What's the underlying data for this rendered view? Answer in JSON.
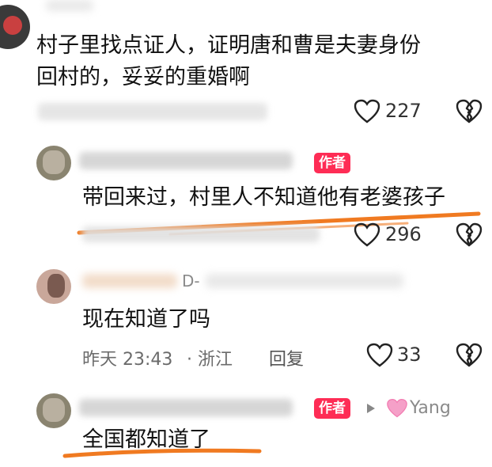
{
  "comments": [
    {
      "text_lines": [
        "村子里找点证人，证明唐和曹是夫妻身份",
        "回村的，妥妥的重婚啊"
      ],
      "likes": "227"
    },
    {
      "badge": "作者",
      "text": "带回来过，村里人不知道他有老婆孩子",
      "likes": "296"
    },
    {
      "username_partial": "D-",
      "text": "现在知道了吗",
      "time": "昨天 23:43",
      "location": "· 浙江",
      "reply_label": "回复",
      "likes": "33"
    },
    {
      "badge": "作者",
      "reply_to": "Yang",
      "text": "全国都知道了"
    }
  ],
  "colors": {
    "accent_badge": "#fe2c55",
    "underline": "#f07a21",
    "yang_heart": "#f5a0c8"
  },
  "icons": {
    "like": "heart-outline-icon",
    "dislike": "broken-heart-icon",
    "reply_arrow": "play-triangle-icon",
    "mini_heart": "pink-heart-icon"
  }
}
